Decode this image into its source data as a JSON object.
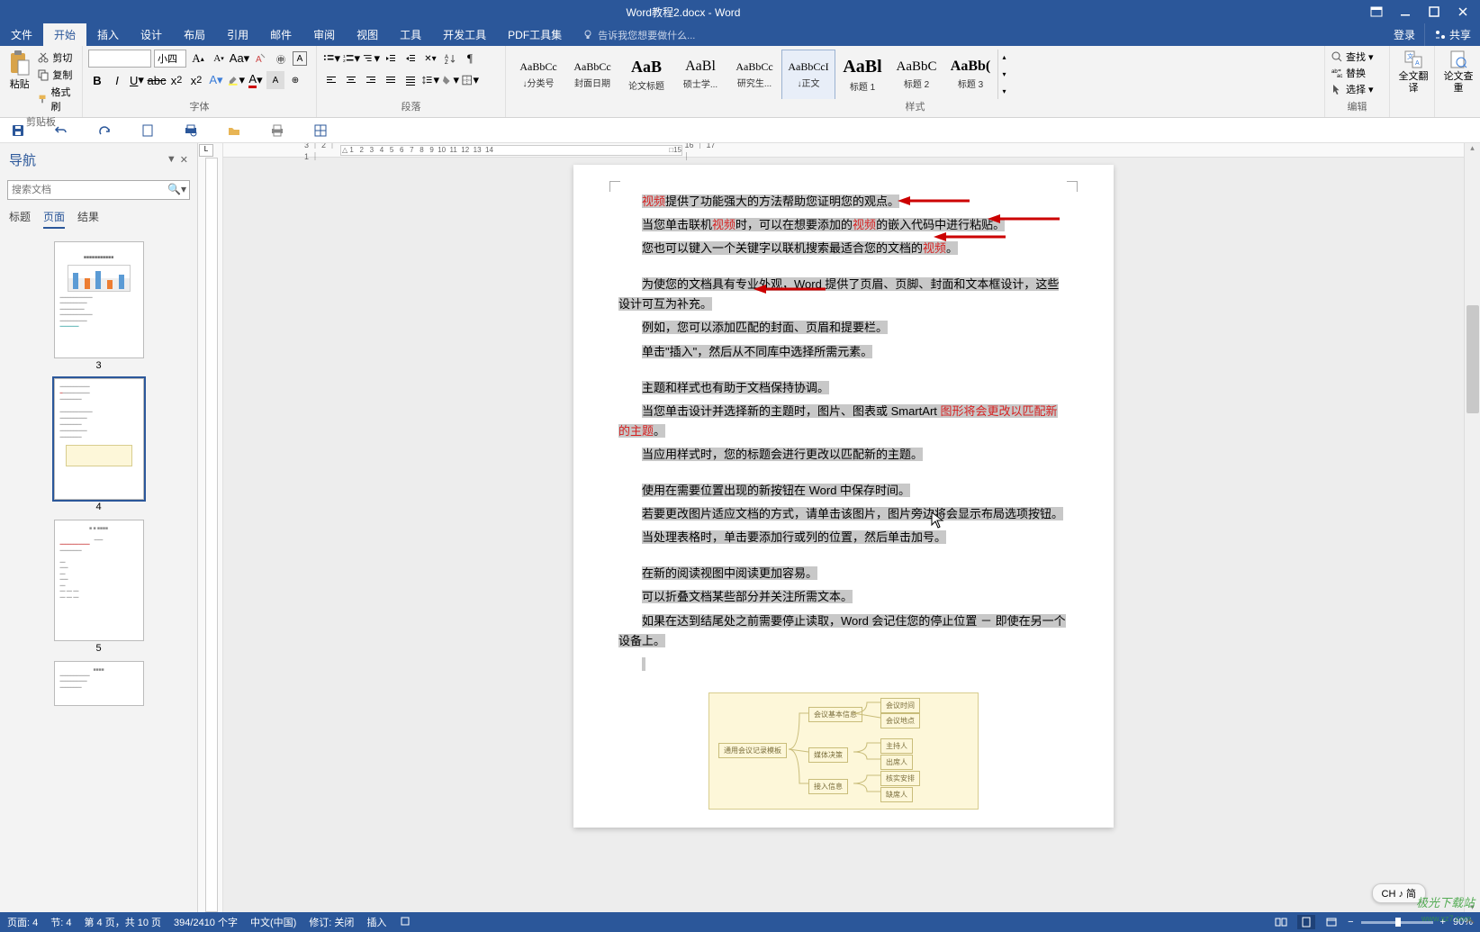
{
  "titlebar": {
    "title": "Word教程2.docx - Word"
  },
  "account": {
    "signin": "登录",
    "share": "共享"
  },
  "tabs": [
    "文件",
    "开始",
    "插入",
    "设计",
    "布局",
    "引用",
    "邮件",
    "审阅",
    "视图",
    "工具",
    "开发工具",
    "PDF工具集"
  ],
  "active_tab": 1,
  "tell_me": "告诉我您想要做什么...",
  "ribbon": {
    "clipboard": {
      "label": "剪贴板",
      "paste": "粘贴",
      "cut": "剪切",
      "copy": "复制",
      "painter": "格式刷"
    },
    "font": {
      "label": "字体",
      "size_label": "小四"
    },
    "paragraph": {
      "label": "段落"
    },
    "styles": {
      "label": "样式",
      "items": [
        {
          "preview": "AaBbCc",
          "name": "↓分类号"
        },
        {
          "preview": "AaBbCc",
          "name": "封面日期"
        },
        {
          "preview": "AaB",
          "name": "论文标题"
        },
        {
          "preview": "AaBl",
          "name": "硕士学..."
        },
        {
          "preview": "AaBbCc",
          "name": "研究生..."
        },
        {
          "preview": "AaBbCcI",
          "name": "↓正文"
        },
        {
          "preview": "AaBl",
          "name": "标题 1"
        },
        {
          "preview": "AaBbC",
          "name": "标题 2"
        },
        {
          "preview": "AaBb(",
          "name": "标题 3"
        }
      ],
      "active": 5
    },
    "editing": {
      "label": "编辑",
      "find": "查找",
      "replace": "替换",
      "select": "选择"
    },
    "translate": {
      "label": "全文翻译"
    },
    "check": {
      "label": "论文查重"
    }
  },
  "nav": {
    "title": "导航",
    "search_placeholder": "搜索文档",
    "tabs": [
      "标题",
      "页面",
      "结果"
    ],
    "active_tab": 1,
    "pages": [
      3,
      4,
      5,
      ""
    ],
    "active_page": 1
  },
  "ruler_ticks": [
    "1",
    "2",
    "1",
    "",
    "1",
    "2",
    "3",
    "4",
    "5",
    "6",
    "7",
    "8",
    "9",
    "10",
    "11",
    "12",
    "13",
    "14",
    "15",
    "16",
    "17"
  ],
  "doc": {
    "p1a": "视频",
    "p1b": "提供了功能强大的方法帮助您证明您的观点。",
    "p2a": "当您单击联机",
    "p2b": "视频",
    "p2c": "时，可以在想要添加的",
    "p2d": "视频",
    "p2e": "的嵌入代码中进行粘贴。",
    "p3a": "您也可以键入一个关键字以联机搜索最适合您的文档的",
    "p3b": "视频",
    "p3c": "。",
    "p4": "为使您的文档具有专业外观，Word 提供了页眉、页脚、封面和文本框设计，这些设计可互为补充。",
    "p5": "例如，您可以添加匹配的封面、页眉和提要栏。",
    "p6": "单击\"插入\"，然后从不同库中选择所需元素。",
    "p7": "主题和样式也有助于文档保持协调。",
    "p8a": "当您单击设计并选择新的主题时，图片、图表或 SmartArt ",
    "p8b": "图形将会更改以匹配新的主题",
    "p8c": "。",
    "p9": "当应用样式时，您的标题会进行更改以匹配新的主题。",
    "p10": "使用在需要位置出现的新按钮在 Word 中保存时间。",
    "p11": "若要更改图片适应文档的方式，请单击该图片，图片旁边将会显示布局选项按钮。",
    "p12": "当处理表格时，单击要添加行或列的位置，然后单击加号。",
    "p13": "在新的阅读视图中阅读更加容易。",
    "p14": "可以折叠文档某些部分并关注所需文本。",
    "p15": "如果在达到结尾处之前需要停止读取，Word 会记住您的停止位置 － 即使在另一个设备上。"
  },
  "mindmap": {
    "center": "通用会议记录模板",
    "n1": "会议基本信息",
    "n2": "媒体决策",
    "n3": "接入信息",
    "n4": "核实安排",
    "n5": "会议时间",
    "n6": "会议地点",
    "n7": "主持人",
    "n8": "出席人",
    "n9": "缺席人"
  },
  "status": {
    "page": "页面: 4",
    "section": "节: 4",
    "pages": "第 4 页，共 10 页",
    "words": "394/2410 个字",
    "lang": "中文(中国)",
    "track": "修订: 关闭",
    "insert": "插入",
    "zoom": "90%"
  },
  "ime": "CH ♪ 简",
  "watermark": "极光下载站",
  "watermark_sub": "www.xz7.com"
}
